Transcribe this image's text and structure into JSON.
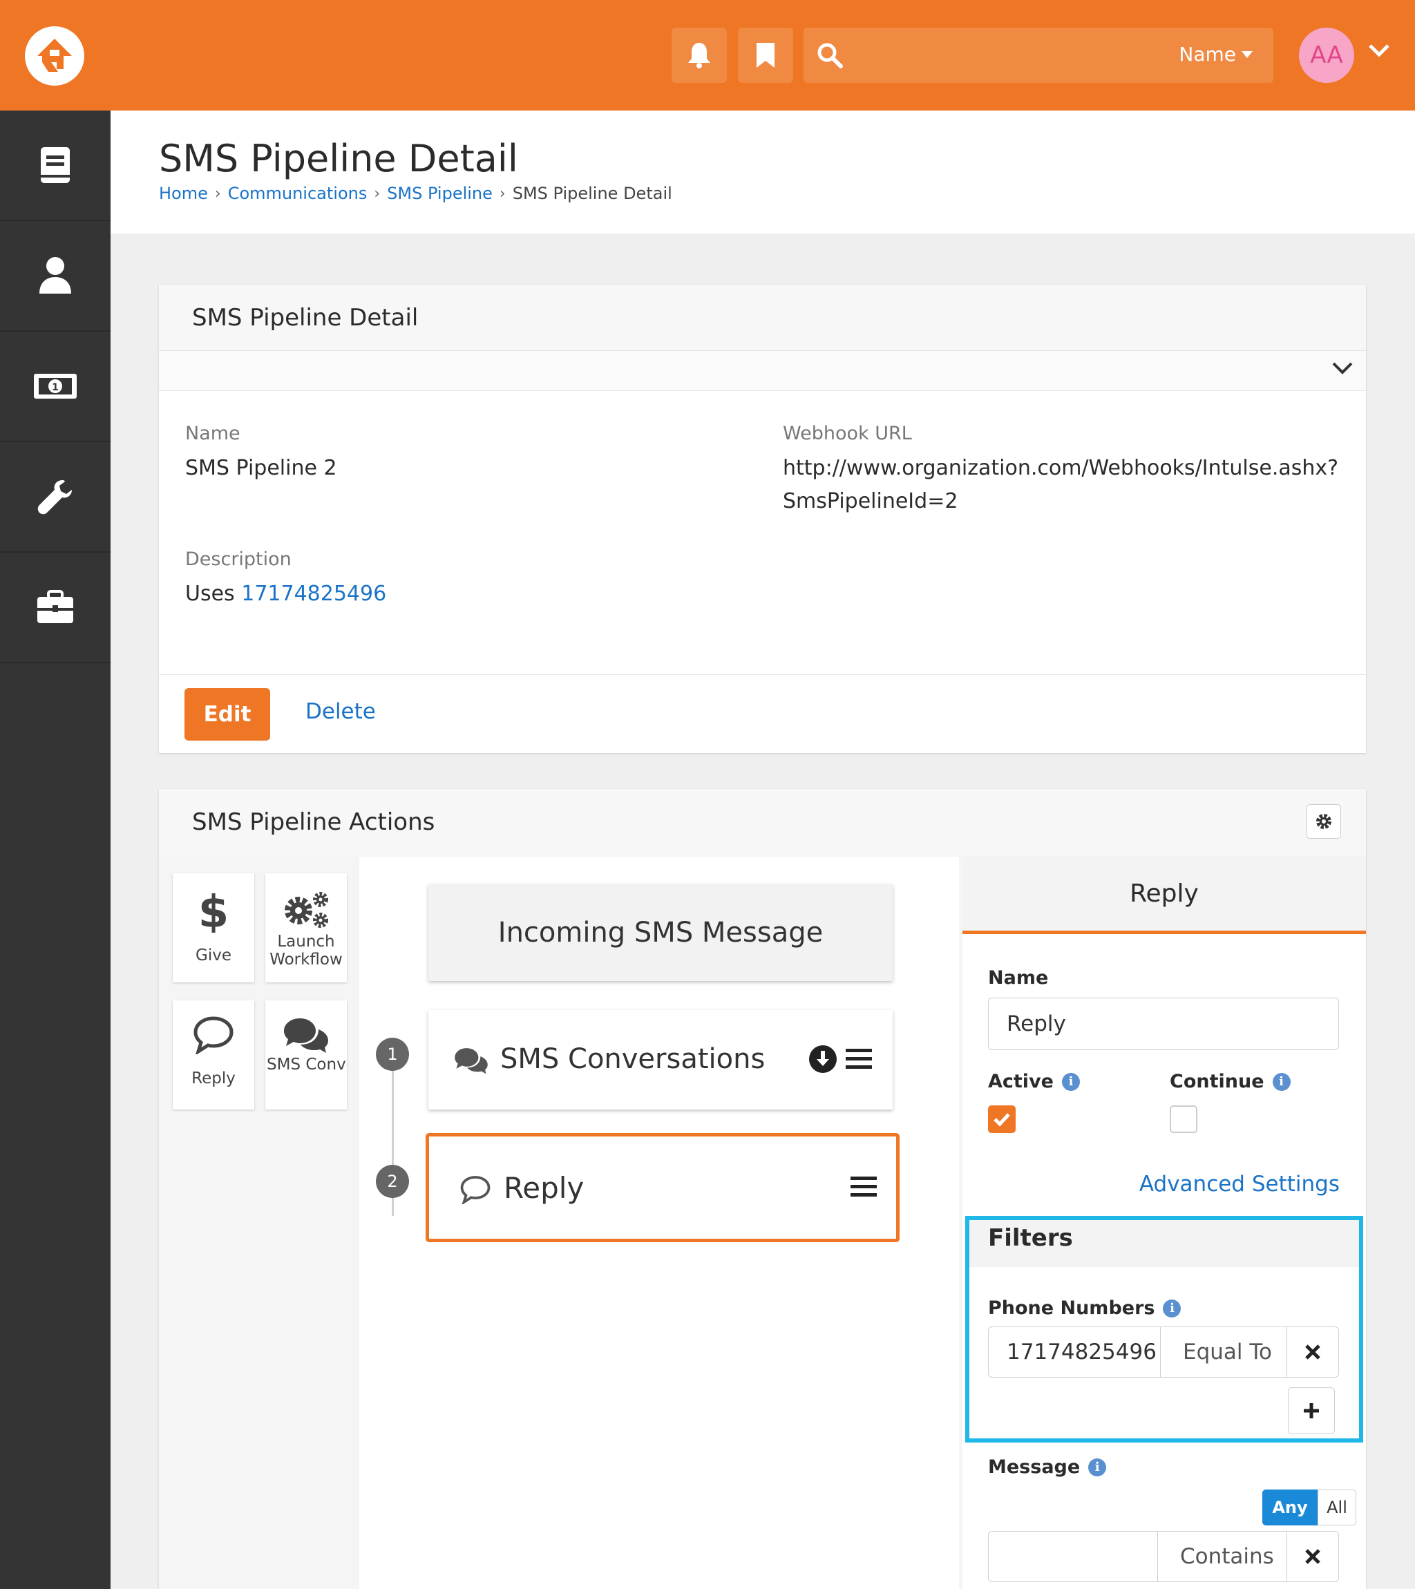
{
  "topbar": {
    "search_scope": "Name",
    "avatar_initials": "AA"
  },
  "sidebar": {
    "items": [
      {
        "icon": "book-icon"
      },
      {
        "icon": "person-icon"
      },
      {
        "icon": "money-icon"
      },
      {
        "icon": "wrench-icon"
      },
      {
        "icon": "briefcase-icon"
      }
    ]
  },
  "page": {
    "title": "SMS Pipeline Detail",
    "breadcrumbs": [
      "Home",
      "Communications",
      "SMS Pipeline",
      "SMS Pipeline Detail"
    ]
  },
  "detail": {
    "title": "SMS Pipeline Detail",
    "name_label": "Name",
    "name_value": "SMS Pipeline 2",
    "webhook_label": "Webhook URL",
    "webhook_line1": "http://www.organization.com/Webhooks/Intulse.ashx?",
    "webhook_line2": "SmsPipelineId=2",
    "description_label": "Description",
    "description_prefix": "Uses",
    "description_link": "17174825496",
    "edit_label": "Edit",
    "delete_label": "Delete"
  },
  "actions": {
    "title": "SMS Pipeline Actions",
    "palette": [
      {
        "label": "Give",
        "icon": "dollar-icon"
      },
      {
        "label": "Launch Workflow",
        "icon": "gears-icon"
      },
      {
        "label": "Reply",
        "icon": "comment-icon"
      },
      {
        "label": "SMS Conversations",
        "icon": "comments-icon"
      }
    ],
    "trigger": "Incoming SMS Message",
    "steps": [
      {
        "number": "1",
        "label": "SMS Conversations"
      },
      {
        "number": "2",
        "label": "Reply"
      }
    ]
  },
  "editor": {
    "title": "Reply",
    "name_label": "Name",
    "name_value": "Reply",
    "active_label": "Active",
    "active_checked": true,
    "continue_label": "Continue",
    "continue_checked": false,
    "advanced_label": "Advanced Settings",
    "filters_title": "Filters",
    "phone_label": "Phone Numbers",
    "phone_value": "17174825496",
    "phone_operator": "Equal To",
    "message_label": "Message",
    "any_label": "Any",
    "all_label": "All",
    "message_value": "",
    "message_operator": "Contains"
  },
  "colors": {
    "brand_orange": "#ee7625",
    "sidebar": "#343434",
    "link_blue": "#1a73c7",
    "highlight_cyan": "#1fb6e8",
    "toggle_blue": "#1a8ad8"
  }
}
